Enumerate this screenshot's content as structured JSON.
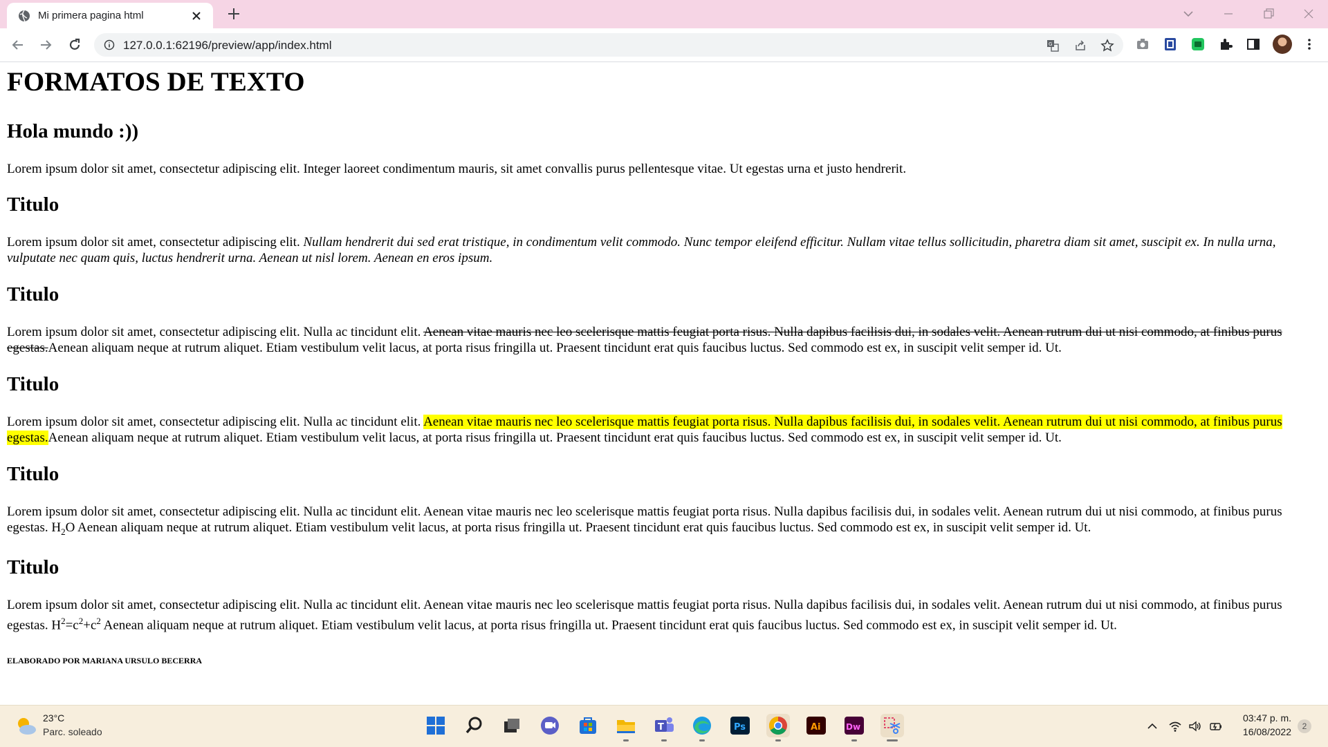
{
  "browser": {
    "tab_title": "Mi primera pagina html",
    "url": "127.0.0.1:62196/preview/app/index.html"
  },
  "page": {
    "h1": "FORMATOS DE TEXTO",
    "h2_first": "Hola mundo :))",
    "p1": "Lorem ipsum dolor sit amet, consectetur adipiscing elit. Integer laoreet condimentum mauris, sit amet convallis purus pellentesque vitae. Ut egestas urna et justo hendrerit.",
    "section_title": "Titulo",
    "p2_plain": "Lorem ipsum dolor sit amet, consectetur adipiscing elit. ",
    "p2_italic": "Nullam hendrerit dui sed erat tristique, in condimentum velit commodo. Nunc tempor eleifend efficitur. Nullam vitae tellus sollicitudin, pharetra diam sit amet, suscipit ex. In nulla urna, vulputate nec quam quis, luctus hendrerit urna. Aenean ut nisl lorem. Aenean en eros ipsum.",
    "p_intro": "Lorem ipsum dolor sit amet, consectetur adipiscing elit. Nulla ac tincidunt elit. ",
    "p_middle": "Aenean vitae mauris nec leo scelerisque mattis feugiat porta risus. Nulla dapibus facilisis dui, in sodales velit. Aenean rutrum dui ut nisi commodo, at finibus purus egestas.",
    "p_tail": "Aenean aliquam neque at rutrum aliquet. Etiam vestibulum velit lacus, at porta risus fringilla ut. Praesent tincidunt erat quis faucibus luctus. Sed commodo est ex, in suscipit velit semper id. Ut.",
    "p5_lead": "Lorem ipsum dolor sit amet, consectetur adipiscing elit. Nulla ac tincidunt elit. Aenean vitae mauris nec leo scelerisque mattis feugiat porta risus. Nulla dapibus facilisis dui, in sodales velit. Aenean rutrum dui ut nisi commodo, at finibus purus egestas. H",
    "p5_sub": "2",
    "p5_rest": "O Aenean aliquam neque at rutrum aliquet. Etiam vestibulum velit lacus, at porta risus fringilla ut. Praesent tincidunt erat quis faucibus luctus. Sed commodo est ex, in suscipit velit semper id. Ut.",
    "p6_lead": "Lorem ipsum dolor sit amet, consectetur adipiscing elit. Nulla ac tincidunt elit. Aenean vitae mauris nec leo scelerisque mattis feugiat porta risus. Nulla dapibus facilisis dui, in sodales velit. Aenean rutrum dui ut nisi commodo, at finibus purus egestas. H",
    "p6_sup1": "2",
    "p6_mid1": "=c",
    "p6_sup2": "2",
    "p6_mid2": "+c",
    "p6_sup3": "2",
    "p6_rest": " Aenean aliquam neque at rutrum aliquet. Etiam vestibulum velit lacus, at porta risus fringilla ut. Praesent tincidunt erat quis faucibus luctus. Sed commodo est ex, in suscipit velit semper id. Ut.",
    "footer": "ELABORADO POR MARIANA URSULO BECERRA"
  },
  "taskbar": {
    "weather_temp": "23°C",
    "weather_desc": "Parc. soleado",
    "time": "03:47 p. m.",
    "date": "16/08/2022",
    "notification_count": "2",
    "apps": [
      "start-icon",
      "search-icon",
      "task-view-icon",
      "chat-icon",
      "store-icon",
      "file-explorer-icon",
      "teams-icon",
      "edge-icon",
      "photoshop-icon",
      "chrome-icon",
      "illustrator-icon",
      "dreamweaver-icon",
      "snipping-tool-icon"
    ]
  },
  "colors": {
    "tabstrip": "#f6d5e5",
    "highlight": "#ffff00",
    "taskbar": "#f7eedd"
  }
}
